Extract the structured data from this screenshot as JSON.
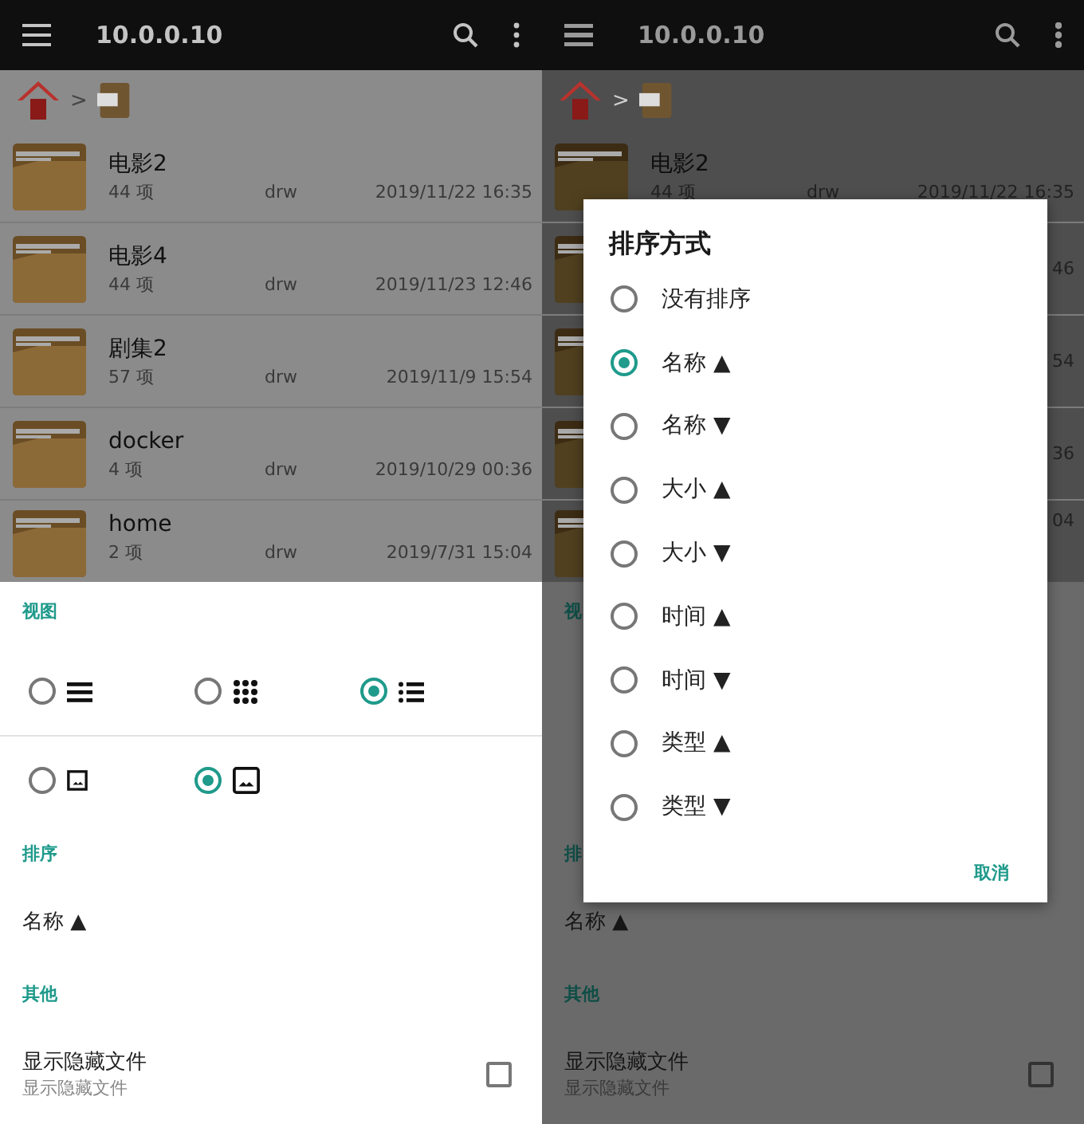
{
  "screens": [
    {
      "app_bar": {
        "title": "10.0.0.10"
      },
      "breadcrumb": {
        "separator": ">"
      },
      "files": [
        {
          "name": "电影2",
          "count": "44 项",
          "perms": "drw",
          "date": "2019/11/22 16:35"
        },
        {
          "name": "电影4",
          "count": "44 项",
          "perms": "drw",
          "date": "2019/11/23 12:46"
        },
        {
          "name": "剧集2",
          "count": "57 项",
          "perms": "drw",
          "date": "2019/11/9 15:54"
        },
        {
          "name": "docker",
          "count": "4 项",
          "perms": "drw",
          "date": "2019/10/29 00:36"
        },
        {
          "name": "home",
          "count": "2 项",
          "perms": "drw",
          "date": "2019/7/31 15:04"
        }
      ],
      "settings_sheet": {
        "sections": [
          {
            "kind": "view",
            "header": "视图",
            "rows": [
              [
                {
                  "selected": false
                },
                {
                  "selected": false
                },
                {
                  "selected": true
                }
              ],
              [
                {
                  "selected": false
                },
                {
                  "selected": true
                }
              ]
            ]
          },
          {
            "kind": "value",
            "header": "排序",
            "value": "名称 ▲"
          },
          {
            "kind": "toggle",
            "header": "其他",
            "title": "显示隐藏文件",
            "subtitle": "显示隐藏文件",
            "checked": false
          }
        ]
      }
    },
    {
      "app_bar": {
        "title": "10.0.0.10"
      },
      "breadcrumb": {
        "separator": ">"
      },
      "files": [
        {
          "name": "电影2",
          "count": "44 项",
          "perms": "drw",
          "date": "2019/11/22 16:35"
        },
        {
          "date": "46"
        },
        {
          "date": "54"
        },
        {
          "date": "36"
        },
        {
          "date": "04"
        }
      ],
      "settings_sheet": {
        "sections": [
          {
            "kind": "view",
            "header": "视"
          },
          {
            "kind": "value",
            "header": "排",
            "value": "名称 ▲"
          },
          {
            "kind": "toggle",
            "header": "其他",
            "title": "显示隐藏文件",
            "subtitle": "显示隐藏文件",
            "checked": false
          }
        ]
      },
      "sort_dialog": {
        "title": "排序方式",
        "options": [
          {
            "label": "没有排序",
            "selected": false
          },
          {
            "label": "名称 ▲",
            "selected": true
          },
          {
            "label": "名称 ▼",
            "selected": false
          },
          {
            "label": "大小 ▲",
            "selected": false
          },
          {
            "label": "大小 ▼",
            "selected": false
          },
          {
            "label": "时间 ▲",
            "selected": false
          },
          {
            "label": "时间 ▼",
            "selected": false
          },
          {
            "label": "类型 ▲",
            "selected": false
          },
          {
            "label": "类型 ▼",
            "selected": false
          }
        ],
        "cancel": "取消"
      }
    }
  ]
}
